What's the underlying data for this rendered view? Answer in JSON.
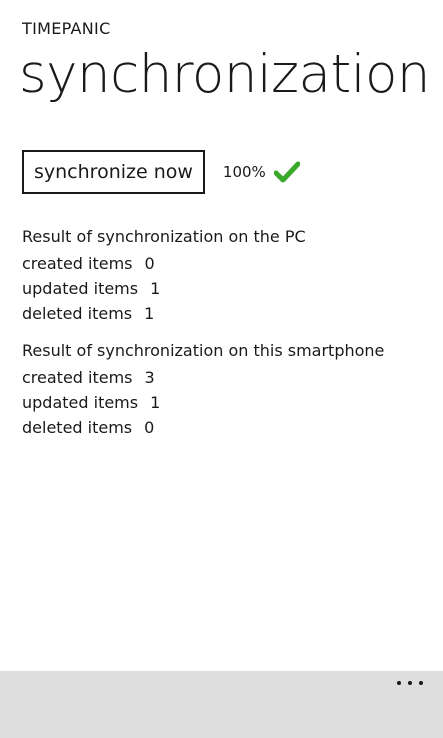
{
  "header": {
    "app_name": "TIMEPANIC",
    "page_title": "synchronization"
  },
  "sync": {
    "button_label": "synchronize now",
    "progress": "100%",
    "status_icon": "checkmark-icon",
    "status_color": "#3aa82a"
  },
  "pc_result": {
    "heading": "Result of synchronization on the PC",
    "rows": [
      {
        "label": "created items",
        "value": "0"
      },
      {
        "label": "updated items",
        "value": "1"
      },
      {
        "label": "deleted items",
        "value": "1"
      }
    ]
  },
  "phone_result": {
    "heading": "Result of synchronization on this smartphone",
    "rows": [
      {
        "label": "created items",
        "value": "3"
      },
      {
        "label": "updated items",
        "value": "1"
      },
      {
        "label": "deleted items",
        "value": "0"
      }
    ]
  },
  "app_bar": {
    "more_icon": "ellipsis-icon",
    "background": "#dedede"
  }
}
